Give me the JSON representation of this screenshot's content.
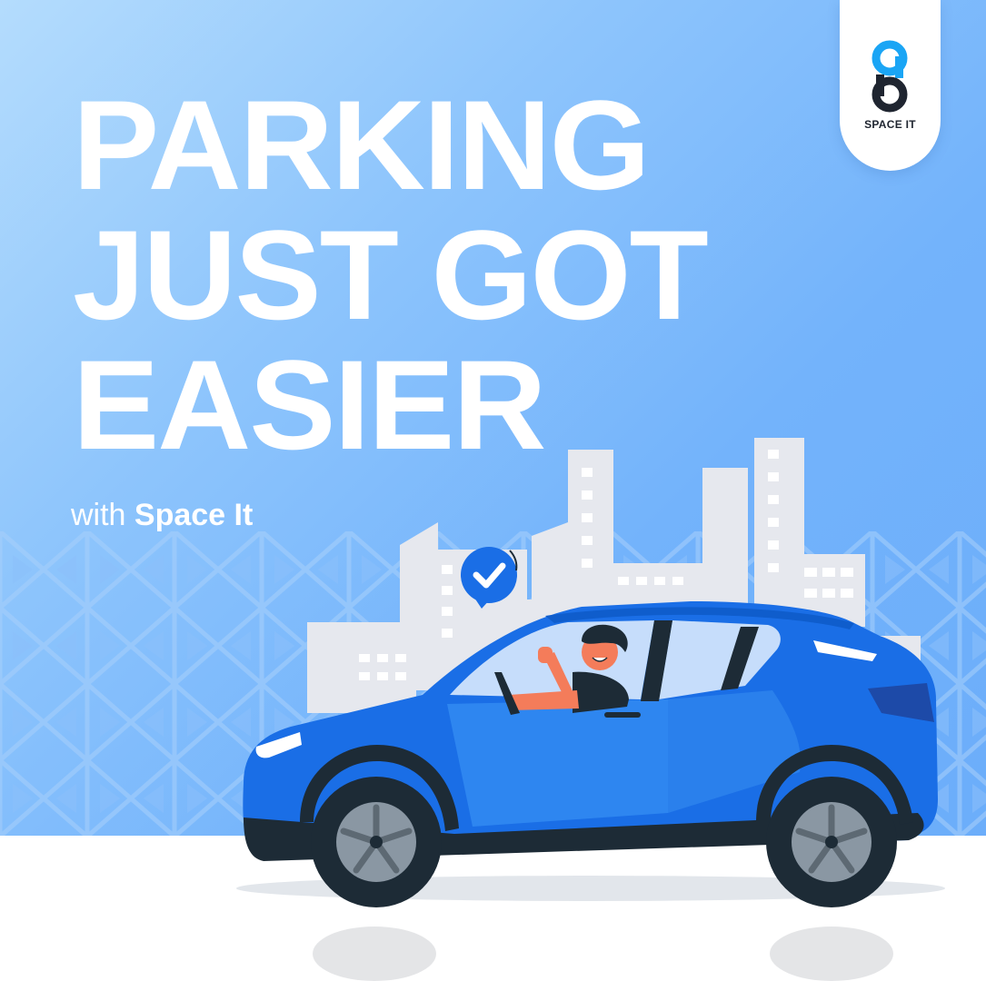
{
  "headline": {
    "line1": "PARKING",
    "line2": "JUST GOT",
    "line3": "EASIER"
  },
  "subline": {
    "prefix": "with",
    "brand": "Space It"
  },
  "logo": {
    "text": "SPACE IT"
  },
  "colors": {
    "background_light": "#b4dcfd",
    "background_dark": "#6aacfa",
    "car_blue": "#1a6ee6",
    "car_dark": "#1d2b36",
    "logo_accent": "#1aa5f5",
    "building_gray": "#e6e8ee"
  },
  "icons": {
    "badge": "check-badge-icon",
    "logo": "space-it-logo-mark"
  }
}
